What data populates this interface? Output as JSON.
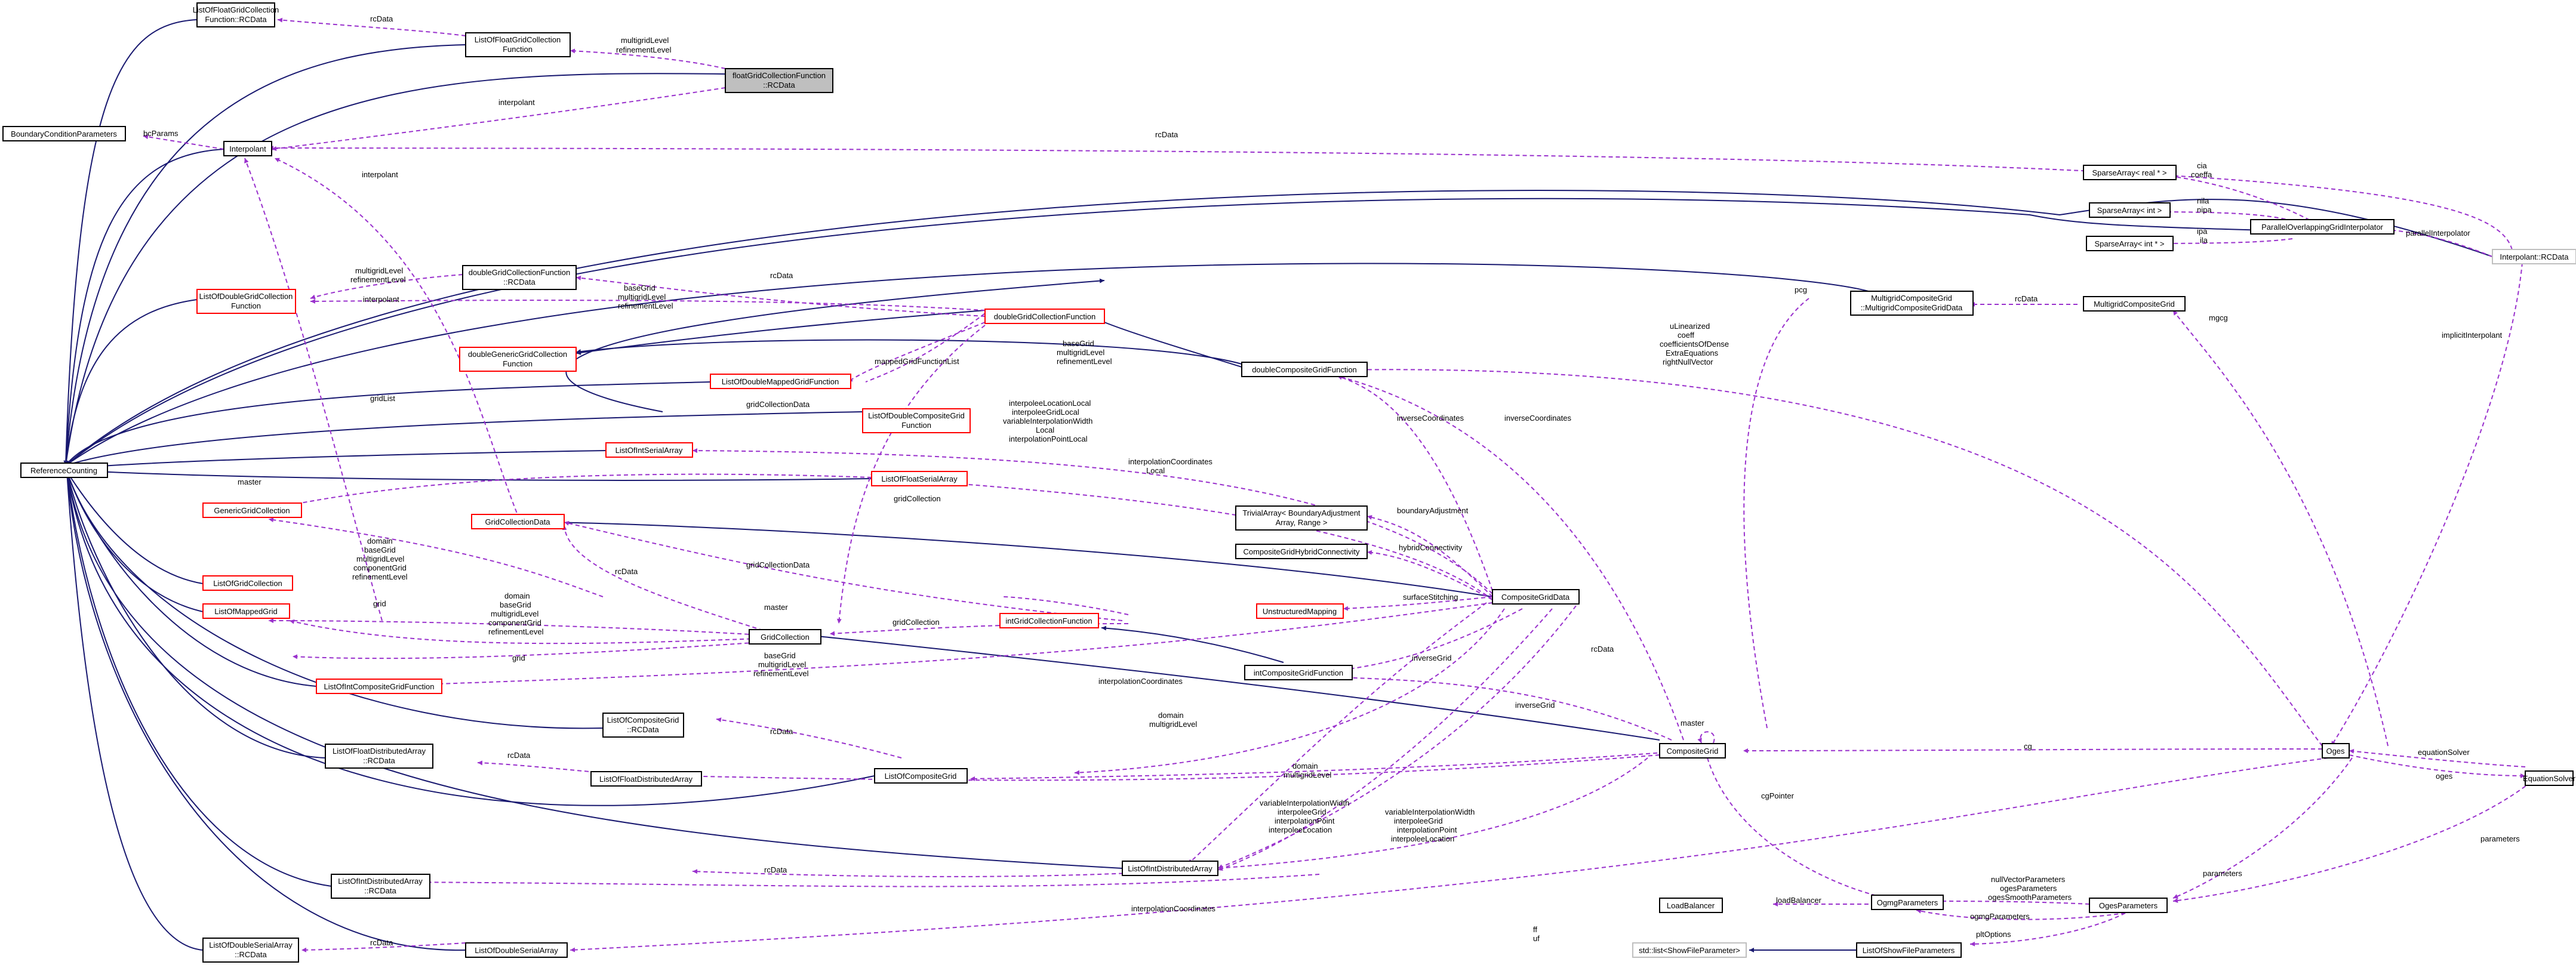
{
  "colors": {
    "inheritance": "#191970",
    "usage": "#9a32cd",
    "focus_fill": "#bfbfbf",
    "undocumented": "#ff0000"
  },
  "nodes": [
    {
      "id": "lofgcf_rc",
      "lines": [
        "ListOfFloatGridCollection",
        "Function::RCData"
      ]
    },
    {
      "id": "lofgcf",
      "lines": [
        "ListOfFloatGridCollection",
        "Function"
      ]
    },
    {
      "id": "fgcf_rc",
      "lines": [
        "floatGridCollectionFunction",
        "::RCData"
      ]
    },
    {
      "id": "bcp",
      "lines": [
        "BoundaryConditionParameters"
      ]
    },
    {
      "id": "interp",
      "lines": [
        "Interpolant"
      ]
    },
    {
      "id": "interp_rc",
      "lines": [
        "Interpolant::RCData"
      ]
    },
    {
      "id": "sa_real",
      "lines": [
        "SparseArray< real * >"
      ]
    },
    {
      "id": "sa_int",
      "lines": [
        "SparseArray< int >"
      ]
    },
    {
      "id": "sa_intp",
      "lines": [
        "SparseArray< int * >"
      ]
    },
    {
      "id": "pogi",
      "lines": [
        "ParallelOverlappingGridInterpolator"
      ]
    },
    {
      "id": "dgcf_rc",
      "lines": [
        "doubleGridCollectionFunction",
        "::RCData"
      ]
    },
    {
      "id": "lodgcf",
      "lines": [
        "ListOfDoubleGridCollection",
        "Function"
      ]
    },
    {
      "id": "dgcf",
      "lines": [
        "doubleGridCollectionFunction"
      ]
    },
    {
      "id": "mcg_rc",
      "lines": [
        "MultigridCompositeGrid",
        "::MultigridCompositeGridData"
      ]
    },
    {
      "id": "mcg",
      "lines": [
        "MultigridCompositeGrid"
      ]
    },
    {
      "id": "dggcf",
      "lines": [
        "doubleGenericGridCollection",
        "Function"
      ]
    },
    {
      "id": "lodmgf",
      "lines": [
        "ListOfDoubleMappedGridFunction"
      ]
    },
    {
      "id": "dcgf",
      "lines": [
        "doubleCompositeGridFunction"
      ]
    },
    {
      "id": "rc",
      "lines": [
        "ReferenceCounting"
      ]
    },
    {
      "id": "loisa",
      "lines": [
        "ListOfIntSerialArray"
      ]
    },
    {
      "id": "lodcgf",
      "lines": [
        "ListOfDoubleCompositeGrid",
        "Function"
      ]
    },
    {
      "id": "gengc",
      "lines": [
        "GenericGridCollection"
      ]
    },
    {
      "id": "lofsa",
      "lines": [
        "ListOfFloatSerialArray"
      ]
    },
    {
      "id": "gcd",
      "lines": [
        "GridCollectionData"
      ]
    },
    {
      "id": "ta",
      "lines": [
        "TrivialArray< BoundaryAdjustment",
        "Array, Range >"
      ]
    },
    {
      "id": "cghc",
      "lines": [
        "CompositeGridHybridConnectivity"
      ]
    },
    {
      "id": "logc",
      "lines": [
        "ListOfGridCollection"
      ]
    },
    {
      "id": "lomg",
      "lines": [
        "ListOfMappedGrid"
      ]
    },
    {
      "id": "umap",
      "lines": [
        "UnstructuredMapping"
      ]
    },
    {
      "id": "cgd",
      "lines": [
        "CompositeGridData"
      ]
    },
    {
      "id": "igcf",
      "lines": [
        "intGridCollectionFunction"
      ]
    },
    {
      "id": "gc",
      "lines": [
        "GridCollection"
      ]
    },
    {
      "id": "loicgf",
      "lines": [
        "ListOfIntCompositeGridFunction"
      ]
    },
    {
      "id": "icgf",
      "lines": [
        "intCompositeGridFunction"
      ]
    },
    {
      "id": "locg_rc",
      "lines": [
        "ListOfCompositeGrid",
        "::RCData"
      ]
    },
    {
      "id": "lofda_rc",
      "lines": [
        "ListOfFloatDistributedArray",
        "::RCData"
      ]
    },
    {
      "id": "lofda",
      "lines": [
        "ListOfFloatDistributedArray"
      ]
    },
    {
      "id": "locg",
      "lines": [
        "ListOfCompositeGrid"
      ]
    },
    {
      "id": "cg",
      "lines": [
        "CompositeGrid"
      ]
    },
    {
      "id": "oges",
      "lines": [
        "Oges"
      ]
    },
    {
      "id": "es",
      "lines": [
        "EquationSolver"
      ]
    },
    {
      "id": "loida_rc",
      "lines": [
        "ListOfIntDistributedArray",
        "::RCData"
      ]
    },
    {
      "id": "loida",
      "lines": [
        "ListOfIntDistributedArray"
      ]
    },
    {
      "id": "lb",
      "lines": [
        "LoadBalancer"
      ]
    },
    {
      "id": "ogmgp",
      "lines": [
        "OgmgParameters"
      ]
    },
    {
      "id": "ogesp",
      "lines": [
        "OgesParameters"
      ]
    },
    {
      "id": "lodsa_rc",
      "lines": [
        "ListOfDoubleSerialArray",
        "::RCData"
      ]
    },
    {
      "id": "lodsa",
      "lines": [
        "ListOfDoubleSerialArray"
      ]
    },
    {
      "id": "stdlist",
      "lines": [
        "std::list<ShowFileParameter>"
      ]
    },
    {
      "id": "losfp",
      "lines": [
        "ListOfShowFileParameters"
      ]
    }
  ],
  "edge_labels": [
    {
      "id": "l01",
      "lines": [
        "rcData"
      ]
    },
    {
      "id": "l02",
      "lines": [
        "multigridLevel",
        "refinementLevel"
      ]
    },
    {
      "id": "l03",
      "lines": [
        "interpolant"
      ]
    },
    {
      "id": "l04",
      "lines": [
        "bcParams"
      ]
    },
    {
      "id": "l05",
      "lines": [
        "rcData"
      ]
    },
    {
      "id": "l06",
      "lines": [
        "interpolant"
      ]
    },
    {
      "id": "l07",
      "lines": [
        "cia",
        "coeffa"
      ]
    },
    {
      "id": "l08",
      "lines": [
        "nila",
        "nipa"
      ]
    },
    {
      "id": "l09",
      "lines": [
        "ipa",
        "ila"
      ]
    },
    {
      "id": "l10",
      "lines": [
        "parallelInterpolator"
      ]
    },
    {
      "id": "l11",
      "lines": [
        "multigridLevel",
        "refinementLevel"
      ]
    },
    {
      "id": "l12",
      "lines": [
        "interpolant"
      ]
    },
    {
      "id": "l13",
      "lines": [
        "rcData"
      ]
    },
    {
      "id": "l14",
      "lines": [
        "baseGrid",
        "multigridLevel",
        "refinementLevel"
      ]
    },
    {
      "id": "l15",
      "lines": [
        "pcg"
      ]
    },
    {
      "id": "l16",
      "lines": [
        "rcData"
      ]
    },
    {
      "id": "l17",
      "lines": [
        "mgcg"
      ]
    },
    {
      "id": "l18",
      "lines": [
        "baseGrid",
        "multigridLevel",
        "refinementLevel"
      ]
    },
    {
      "id": "l19",
      "lines": [
        "mappedGridFunctionList"
      ]
    },
    {
      "id": "l20",
      "lines": [
        "uLinearized",
        "coeff",
        "coefficientsOfDense",
        "ExtraEquations",
        "rightNullVector"
      ]
    },
    {
      "id": "l21",
      "lines": [
        "implicitInterpolant"
      ]
    },
    {
      "id": "l22",
      "lines": [
        "gridList"
      ]
    },
    {
      "id": "l23",
      "lines": [
        "gridCollectionData"
      ]
    },
    {
      "id": "l24",
      "lines": [
        "interpoleeLocationLocal",
        "interpoleeGridLocal",
        "variableInterpolationWidth",
        "Local",
        "interpolationPointLocal"
      ]
    },
    {
      "id": "l25",
      "lines": [
        "inverseCoordinates"
      ]
    },
    {
      "id": "l26",
      "lines": [
        "inverseCoordinates"
      ]
    },
    {
      "id": "l27",
      "lines": [
        "master"
      ]
    },
    {
      "id": "l28",
      "lines": [
        "interpolationCoordinates",
        "Local"
      ]
    },
    {
      "id": "l29",
      "lines": [
        "gridCollection"
      ]
    },
    {
      "id": "l30",
      "lines": [
        "boundaryAdjustment"
      ]
    },
    {
      "id": "l31",
      "lines": [
        "domain",
        "baseGrid",
        "multigridLevel",
        "componentGrid",
        "refinementLevel"
      ]
    },
    {
      "id": "l32",
      "lines": [
        "hybridConnectivity"
      ]
    },
    {
      "id": "l33",
      "lines": [
        "rcData"
      ]
    },
    {
      "id": "l34",
      "lines": [
        "gridCollectionData"
      ]
    },
    {
      "id": "l35",
      "lines": [
        "surfaceStitching"
      ]
    },
    {
      "id": "l36",
      "lines": [
        "grid"
      ]
    },
    {
      "id": "l37",
      "lines": [
        "master"
      ]
    },
    {
      "id": "l38",
      "lines": [
        "gridCollection"
      ]
    },
    {
      "id": "l39",
      "lines": [
        "domain",
        "baseGrid",
        "multigridLevel",
        "componentGrid",
        "refinementLevel"
      ]
    },
    {
      "id": "l40",
      "lines": [
        "grid"
      ]
    },
    {
      "id": "l41",
      "lines": [
        "baseGrid",
        "multigridLevel",
        "refinementLevel"
      ]
    },
    {
      "id": "l42",
      "lines": [
        "rcData"
      ]
    },
    {
      "id": "l43",
      "lines": [
        "inverseGrid"
      ]
    },
    {
      "id": "l44",
      "lines": [
        "interpolationCoordinates"
      ]
    },
    {
      "id": "l45",
      "lines": [
        "inverseGrid"
      ]
    },
    {
      "id": "l46",
      "lines": [
        "rcData"
      ]
    },
    {
      "id": "l47",
      "lines": [
        "domain",
        "multigridLevel"
      ]
    },
    {
      "id": "l48",
      "lines": [
        "master"
      ]
    },
    {
      "id": "l49",
      "lines": [
        "cg"
      ]
    },
    {
      "id": "l50",
      "lines": [
        "equationSolver"
      ]
    },
    {
      "id": "l51",
      "lines": [
        "rcData"
      ]
    },
    {
      "id": "l52",
      "lines": [
        "domain",
        "multigridLevel"
      ]
    },
    {
      "id": "l53",
      "lines": [
        "oges"
      ]
    },
    {
      "id": "l54",
      "lines": [
        "cgPointer"
      ]
    },
    {
      "id": "l55",
      "lines": [
        "variableInterpolationWidth",
        "interpoleeGrid",
        "interpolationPoint",
        "interpoleeLocation"
      ]
    },
    {
      "id": "l56",
      "lines": [
        "variableInterpolationWidth",
        "interpoleeGrid",
        "interpolationPoint",
        "interpoleeLocation"
      ]
    },
    {
      "id": "l57",
      "lines": [
        "parameters"
      ]
    },
    {
      "id": "l58",
      "lines": [
        "rcData"
      ]
    },
    {
      "id": "l59",
      "lines": [
        "loadBalancer"
      ]
    },
    {
      "id": "l60",
      "lines": [
        "nullVectorParameters",
        "ogesParameters",
        "ogesSmoothParameters"
      ]
    },
    {
      "id": "l61",
      "lines": [
        "parameters"
      ]
    },
    {
      "id": "l62",
      "lines": [
        "interpolationCoordinates"
      ]
    },
    {
      "id": "l63",
      "lines": [
        "ogmgParameters"
      ]
    },
    {
      "id": "l64",
      "lines": [
        "rcData"
      ]
    },
    {
      "id": "l65",
      "lines": [
        "pltOptions"
      ]
    },
    {
      "id": "l66",
      "lines": [
        "ff",
        "uf"
      ]
    }
  ]
}
